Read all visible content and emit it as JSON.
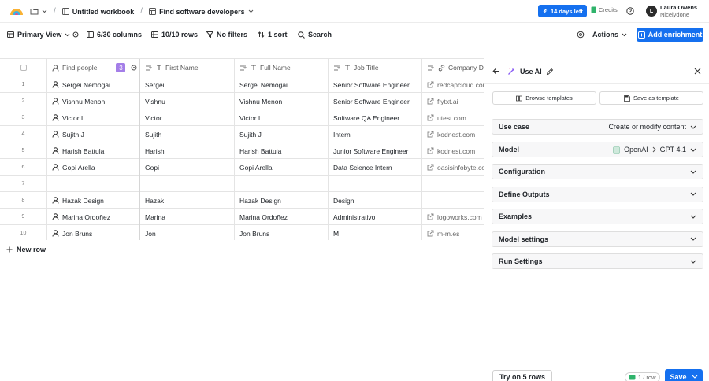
{
  "topbar": {
    "workbook": "Untitled workbook",
    "table": "Find software developers",
    "trial": "14 days left",
    "credits": "Credits",
    "user_initial": "L",
    "user_name": "Laura Owens",
    "user_org": "Niceiydone"
  },
  "toolbar": {
    "view": "Primary View",
    "columns": "6/30 columns",
    "rows": "10/10 rows",
    "filters": "No filters",
    "sort": "1 sort",
    "search": "Search",
    "actions": "Actions",
    "add_enrichment": "Add enrichment"
  },
  "grid": {
    "headers": [
      "Find people",
      "First Name",
      "Full Name",
      "Job Title",
      "Company Do"
    ],
    "find_people_badge": "3",
    "rows": [
      {
        "n": "1",
        "person": "Sergei Nemogai",
        "first": "Sergei",
        "full": "Sergei Nemogai",
        "title": "Senior Software Engineer",
        "domain": "redcapcloud.com"
      },
      {
        "n": "2",
        "person": "Vishnu Menon",
        "first": "Vishnu",
        "full": "Vishnu Menon",
        "title": "Senior Software Engineer",
        "domain": "flytxt.ai"
      },
      {
        "n": "3",
        "person": "Victor I.",
        "first": "Victor",
        "full": "Victor I.",
        "title": "Software QA Engineer",
        "domain": "utest.com"
      },
      {
        "n": "4",
        "person": "Sujith J",
        "first": "Sujith",
        "full": "Sujith J",
        "title": "Intern",
        "domain": "kodnest.com"
      },
      {
        "n": "5",
        "person": "Harish Battula",
        "first": "Harish",
        "full": "Harish Battula",
        "title": "Junior Software Engineer",
        "domain": "kodnest.com"
      },
      {
        "n": "6",
        "person": "Gopi Arella",
        "first": "Gopi",
        "full": "Gopi Arella",
        "title": "Data Science Intern",
        "domain": "oasisinfobyte.co"
      },
      {
        "n": "7",
        "person": "",
        "first": "",
        "full": "",
        "title": "",
        "domain": ""
      },
      {
        "n": "8",
        "person": "Hazak Design",
        "first": "Hazak",
        "full": "Hazak Design",
        "title": "Design",
        "domain": ""
      },
      {
        "n": "9",
        "person": "Marina Ordoñez",
        "first": "Marina",
        "full": "Marina Ordoñez",
        "title": "Administrativo",
        "domain": "logoworks.com"
      },
      {
        "n": "10",
        "person": "Jon Bruns",
        "first": "Jon",
        "full": "Jon Bruns",
        "title": "M",
        "domain": "m-m.es"
      }
    ],
    "new_row": "New row"
  },
  "panel": {
    "title": "Use AI",
    "browse_templates": "Browse templates",
    "save_as_template": "Save as template",
    "use_case_label": "Use case",
    "use_case_value": "Create or modify content",
    "model_label": "Model",
    "model_provider": "OpenAI",
    "model_name": "GPT 4.1",
    "sections": [
      "Configuration",
      "Define Outputs",
      "Examples",
      "Model settings",
      "Run Settings"
    ],
    "try_label": "Try on 5 rows",
    "cost": "1 / row",
    "save": "Save"
  },
  "colors": {
    "accent": "#1570ef",
    "badge": "#a47ee8",
    "credits": "#2fb36b"
  }
}
